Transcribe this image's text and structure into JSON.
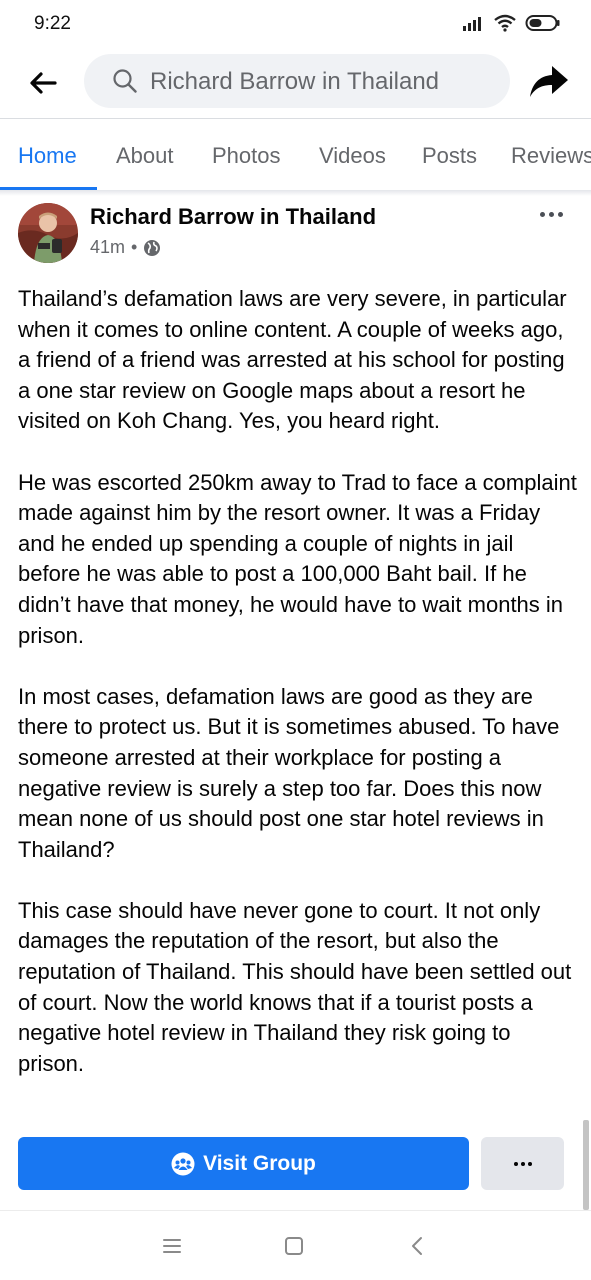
{
  "status_bar": {
    "time": "9:22",
    "icons": [
      "signal-icon",
      "wifi-icon",
      "battery-icon"
    ]
  },
  "top_bar": {
    "back_icon": "back-arrow-icon",
    "search_text": "Richard Barrow in Thailand",
    "share_icon": "share-arrow-icon"
  },
  "tabs": [
    {
      "label": "Home",
      "active": true
    },
    {
      "label": "About",
      "active": false
    },
    {
      "label": "Photos",
      "active": false
    },
    {
      "label": "Videos",
      "active": false
    },
    {
      "label": "Posts",
      "active": false
    },
    {
      "label": "Reviews",
      "active": false
    }
  ],
  "post": {
    "author": "Richard Barrow in Thailand",
    "time": "41m",
    "separator": "•",
    "privacy_icon": "globe-icon",
    "paragraphs": [
      "Thailand’s defamation laws are very severe, in particular when it comes to online content. A couple of weeks ago, a friend of a friend was arrested at his school for posting a one star review on Google maps about a resort he visited on Koh Chang. Yes, you heard right.",
      "He was escorted 250km away to Trad to face a complaint made against him by the resort owner. It was a Friday and he ended up spending a couple of nights in jail before he was able to post a 100,000 Baht bail. If he didn’t have that money, he would have to wait months in prison.",
      "In most cases, defamation laws are good as they are there to protect us. But it is sometimes abused. To have someone arrested at their workplace for posting a negative review is surely a step too far. Does this now mean none of us should post one star hotel reviews in Thailand?",
      "This case should have never gone to court. It not only damages the reputation of the resort, but also the reputation of Thailand. This should have been settled out of court. Now the world knows that if a tourist posts a negative hotel review in Thailand they risk going to prison."
    ]
  },
  "actions": {
    "visit_group_label": "Visit Group",
    "visit_group_icon": "group-icon",
    "more_icon": "more-dots-icon"
  },
  "nav_bar": {
    "icons": [
      "menu-icon",
      "home-square-icon",
      "back-chevron-icon"
    ]
  },
  "colors": {
    "accent": "#1877f2",
    "secondary_text": "#65676b",
    "search_bg": "#f0f2f5",
    "button_gray": "#e4e6eb"
  }
}
